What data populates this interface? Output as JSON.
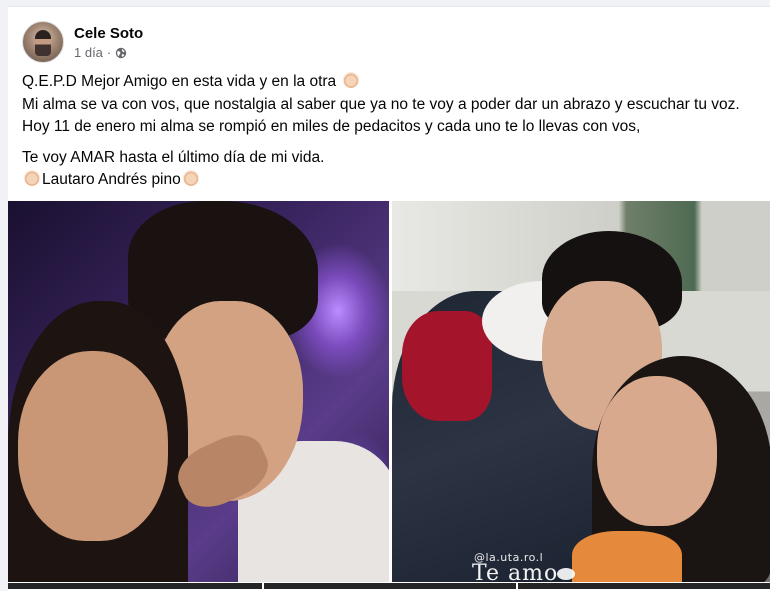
{
  "post": {
    "author": "Cele Soto",
    "time": "1 día",
    "separator": "·",
    "privacy_icon": "globe-icon",
    "lines": [
      "Q.E.P.D Mejor Amigo en esta vida y en la otra",
      "Mi alma se va con vos, que nostalgia al saber que ya no te voy a poder dar un abrazo y escuchar tu voz. Hoy 11 de enero mi alma se rompió en miles de pedacitos y cada uno te lo llevas con vos,",
      "Te voy AMAR hasta el último día de mi vida.",
      "Lautaro Andrés pino"
    ],
    "emoji_icon": "baby-emoji-icon"
  },
  "photos": {
    "right_overlay_handle": "@la.uta.ro.l",
    "right_overlay_caption": "Te amo"
  },
  "colors": {
    "page_bg": "#f0f2f5",
    "card_bg": "#ffffff",
    "text": "#050505",
    "secondary_text": "#65676b"
  }
}
